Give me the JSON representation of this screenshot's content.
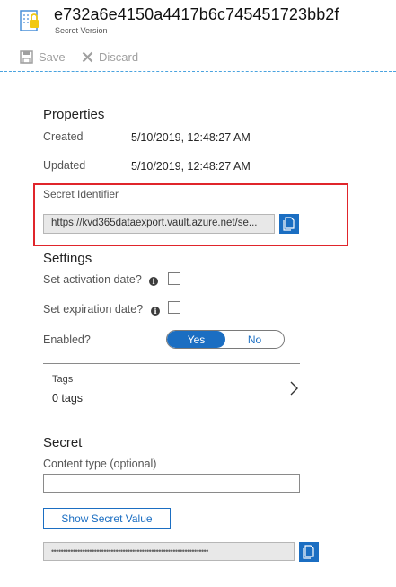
{
  "header": {
    "title": "e732a6e4150a4417b6c745451723bb2f",
    "subtitle": "Secret Version",
    "icon": "key-vault-secret-icon"
  },
  "toolbar": {
    "save_label": "Save",
    "discard_label": "Discard"
  },
  "properties": {
    "title": "Properties",
    "created_label": "Created",
    "created_value": "5/10/2019, 12:48:27 AM",
    "updated_label": "Updated",
    "updated_value": "5/10/2019, 12:48:27 AM",
    "identifier_label": "Secret Identifier",
    "identifier_value": "https://kvd365dataexport.vault.azure.net/se..."
  },
  "settings": {
    "title": "Settings",
    "activation_label": "Set activation date?",
    "expiration_label": "Set expiration date?",
    "enabled_label": "Enabled?",
    "enabled_yes": "Yes",
    "enabled_no": "No"
  },
  "tags": {
    "label": "Tags",
    "value": "0 tags"
  },
  "secret": {
    "title": "Secret",
    "content_type_label": "Content type (optional)",
    "content_type_value": "",
    "show_button_label": "Show Secret Value",
    "masked_value": "••••••••••••••••••••••••••••••••••••••••••••••••••••••••••••••••••"
  },
  "colors": {
    "accent": "#1b6ec2",
    "highlight_box": "#e0252b",
    "toolbar_divider": "#4aa3df"
  }
}
